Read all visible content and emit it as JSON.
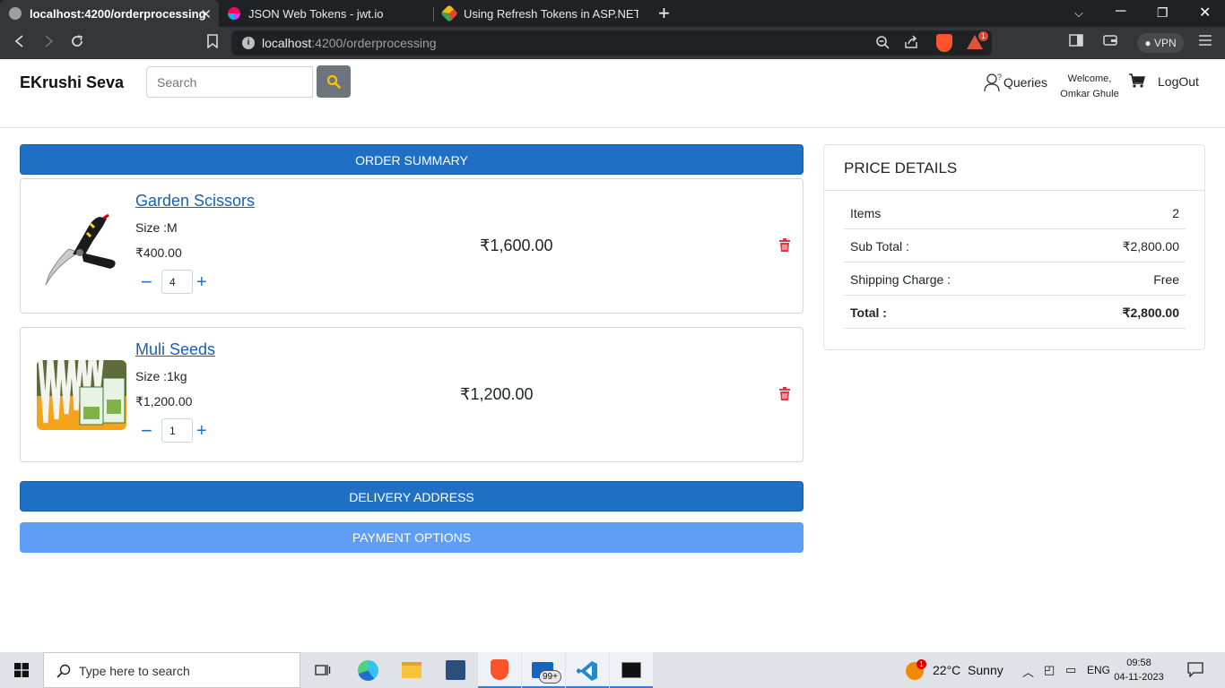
{
  "browser": {
    "tabs": [
      {
        "title": "localhost:4200/orderprocessing",
        "active": true
      },
      {
        "title": "JSON Web Tokens - jwt.io",
        "active": false
      },
      {
        "title": "Using Refresh Tokens in ASP.NET Core",
        "active": false
      }
    ],
    "url_host": "localhost",
    "url_path": ":4200/orderprocessing",
    "rewards_badge": "1",
    "vpn_label": "VPN"
  },
  "header": {
    "brand": "EKrushi Seva",
    "search_placeholder": "Search",
    "queries_label": "Queries",
    "welcome_line1": "Welcome,",
    "welcome_line2": "Omkar Ghule",
    "logout_label": "LogOut"
  },
  "sections": {
    "order_summary": "ORDER SUMMARY",
    "delivery_address": "DELIVERY ADDRESS",
    "payment_options": "PAYMENT OPTIONS"
  },
  "cart_items": [
    {
      "name": "Garden Scissors",
      "size": "Size :M",
      "unit_price": "₹400.00",
      "quantity": "4",
      "line_total": "₹1,600.00",
      "image_icon": "garden-scissors-image"
    },
    {
      "name": "Muli Seeds",
      "size": "Size :1kg",
      "unit_price": "₹1,200.00",
      "quantity": "1",
      "line_total": "₹1,200.00",
      "image_icon": "muli-seeds-image"
    }
  ],
  "price_details": {
    "title": "PRICE DETAILS",
    "rows": [
      {
        "label": "Items",
        "value": "2"
      },
      {
        "label": "Sub Total :",
        "value": "₹2,800.00"
      },
      {
        "label": "Shipping Charge :",
        "value": "Free"
      },
      {
        "label": "Total :",
        "value": "₹2,800.00"
      }
    ]
  },
  "taskbar": {
    "search_placeholder": "Type here to search",
    "mail_badge": "99+",
    "weather_badge": "1",
    "weather": "22°C  Sunny",
    "language": "ENG",
    "time": "09:58",
    "date": "04-11-2023"
  },
  "colors": {
    "primary": "#1f6fc4",
    "primary_light": "#5e9ef4",
    "danger": "#dc3545",
    "search_button": "#6c757d"
  }
}
